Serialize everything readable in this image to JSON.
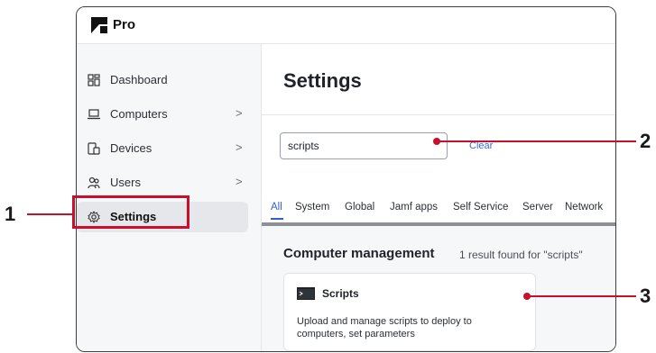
{
  "app": {
    "brand": "Pro"
  },
  "sidebar": {
    "items": [
      {
        "label": "Dashboard",
        "icon": "dashboard-icon",
        "chevron": ""
      },
      {
        "label": "Computers",
        "icon": "laptop-icon",
        "chevron": ">"
      },
      {
        "label": "Devices",
        "icon": "devices-icon",
        "chevron": ">"
      },
      {
        "label": "Users",
        "icon": "users-icon",
        "chevron": ">"
      },
      {
        "label": "Settings",
        "icon": "gear-icon",
        "chevron": "",
        "active": true
      }
    ]
  },
  "main": {
    "title": "Settings",
    "search": {
      "value": "scripts",
      "clear_label": "Clear"
    },
    "tabs": [
      "All",
      "System",
      "Global",
      "Jamf apps",
      "Self Service",
      "Server",
      "Network"
    ],
    "active_tab": "All",
    "section": {
      "title": "Computer management",
      "result_count": "1 result found for \"scripts\"",
      "card": {
        "title": "Scripts",
        "icon": "terminal-icon",
        "description": "Upload and manage scripts to deploy to computers, set parameters"
      }
    }
  },
  "annotations": [
    {
      "number": "1"
    },
    {
      "number": "2"
    },
    {
      "number": "3"
    }
  ],
  "colors": {
    "annotation": "#c8102e",
    "accent": "#2d5fd1"
  }
}
